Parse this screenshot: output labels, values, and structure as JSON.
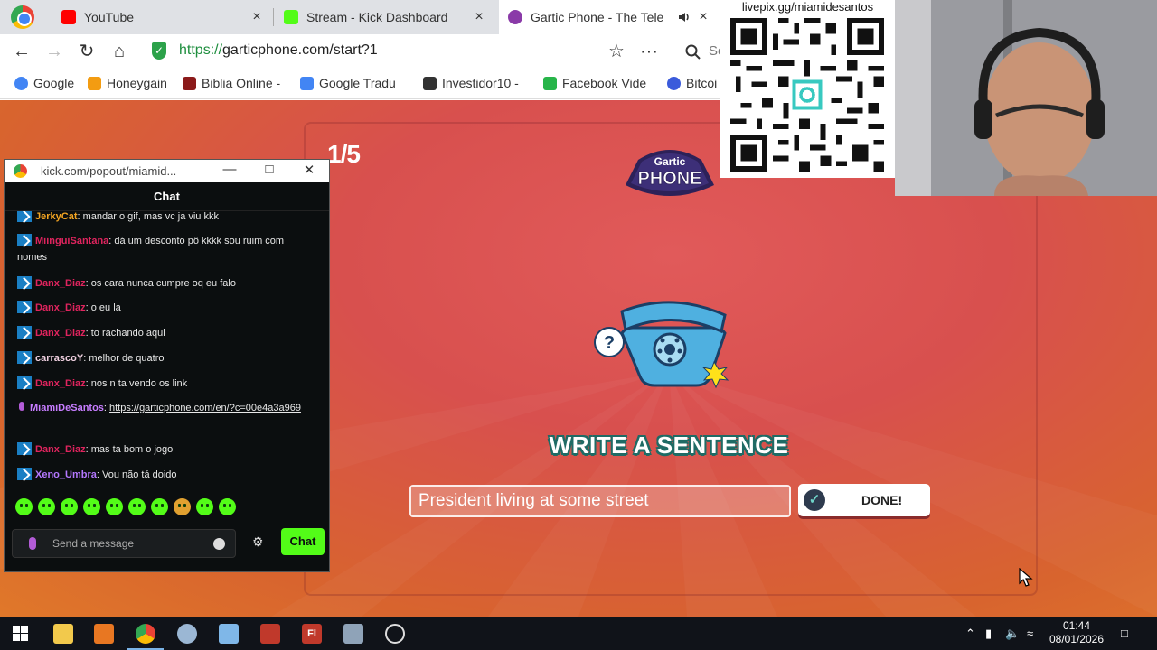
{
  "browser": {
    "tabs": [
      {
        "title": "YouTube",
        "close": "×",
        "favicon_color": "#ff0000"
      },
      {
        "title": "Stream - Kick Dashboard",
        "close": "×",
        "favicon_color": "#53fc18"
      },
      {
        "title": "Gartic Phone - The Tele",
        "close": "×",
        "favicon_color": "#8a3aa8",
        "audio_icon": "speaker-icon"
      }
    ],
    "url_scheme": "https://",
    "url_host": "garticphone.com/start?1",
    "bookmarks": [
      {
        "label": "Google",
        "color": "#4285f4"
      },
      {
        "label": "Honeygain",
        "color": "#f39c12"
      },
      {
        "label": "Biblia Online -",
        "color": "#8b1a1a"
      },
      {
        "label": "Google Tradu",
        "color": "#4285f4"
      },
      {
        "label": "Investidor10 -",
        "color": "#333333"
      },
      {
        "label": "Facebook Vide",
        "color": "#1877f2"
      },
      {
        "label": "Bitcoi",
        "color": "#3b5bdb"
      }
    ],
    "search_partial": "Se"
  },
  "qr": {
    "caption": "livepix.gg/miamidesantos"
  },
  "chat": {
    "window_url": "kick.com/popout/miamid...",
    "header": "Chat",
    "messages": [
      {
        "user": "JerkyCat",
        "user_color": "#f5a623",
        "text": ": mandar o gif, mas vc ja viu kkk",
        "badge": "pro"
      },
      {
        "user": "MiinguiSantana",
        "user_color": "#e0245e",
        "text": ": dá um desconto pô kkkk sou ruim com nomes",
        "badge": "pro"
      },
      {
        "user": "Danx_Diaz",
        "user_color": "#e0245e",
        "text": ": os cara nunca cumpre oq eu falo",
        "badge": "pro"
      },
      {
        "user": "Danx_Diaz",
        "user_color": "#e0245e",
        "text": ": o eu la",
        "badge": "pro"
      },
      {
        "user": "Danx_Diaz",
        "user_color": "#e0245e",
        "text": ": to rachando aqui",
        "badge": "pro"
      },
      {
        "user": "carrascoY",
        "user_color": "#f0d0e0",
        "text": ": melhor de quatro",
        "badge": "pro"
      },
      {
        "user": "Danx_Diaz",
        "user_color": "#e0245e",
        "text": ": nos n ta vendo os link",
        "badge": "pro"
      },
      {
        "user": "MiamiDeSantos",
        "user_color": "#c77dff",
        "text": ": ",
        "link": "https://garticphone.com/en/?c=00e4a3a969",
        "badge": "mic"
      },
      {
        "user": "Danx_Diaz",
        "user_color": "#e0245e",
        "text": ": mas ta bom o jogo",
        "badge": "pro"
      },
      {
        "user": "Xeno_Umbra",
        "user_color": "#b478ff",
        "text": ": Vou não tá doido",
        "badge": "pro"
      }
    ],
    "input_placeholder": "Send a message",
    "send_label": "Chat"
  },
  "game": {
    "round": "1/5",
    "logo_line1": "Gartic",
    "logo_line2": "PHONE",
    "instruction": "WRITE A SENTENCE",
    "sentence_value": "President living at some street",
    "done_label": "DONE!"
  },
  "taskbar": {
    "time": "01:44",
    "date": "08/01/2026"
  }
}
